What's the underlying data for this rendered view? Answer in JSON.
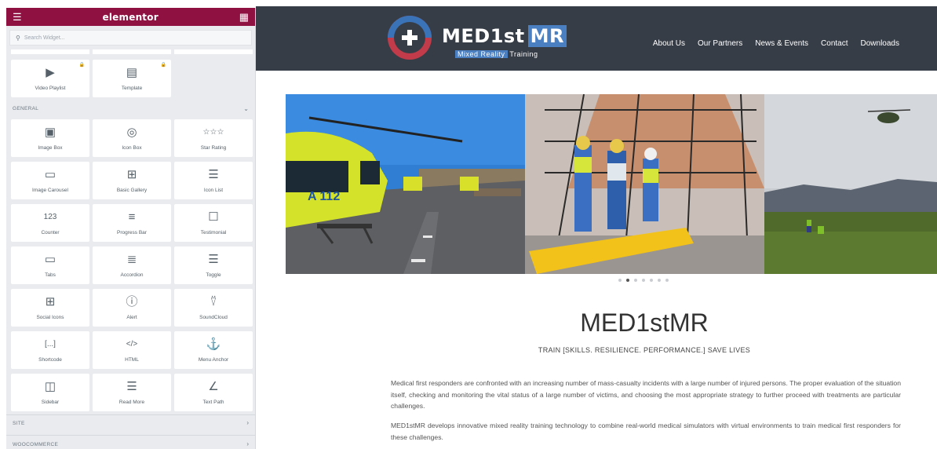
{
  "panel": {
    "brand": "elementor",
    "search_placeholder": "Search Widget...",
    "top_widgets": [
      {
        "label": "Video Playlist",
        "icon": "video-playlist-icon",
        "locked": true
      },
      {
        "label": "Template",
        "icon": "template-icon",
        "locked": true
      }
    ],
    "general_section": {
      "title": "GENERAL",
      "widgets": [
        {
          "label": "Image Box",
          "icon": "image-box-icon"
        },
        {
          "label": "Icon Box",
          "icon": "icon-box-icon"
        },
        {
          "label": "Star Rating",
          "icon": "star-rating-icon"
        },
        {
          "label": "Image Carousel",
          "icon": "image-carousel-icon"
        },
        {
          "label": "Basic Gallery",
          "icon": "basic-gallery-icon"
        },
        {
          "label": "Icon List",
          "icon": "icon-list-icon"
        },
        {
          "label": "Counter",
          "icon": "counter-icon"
        },
        {
          "label": "Progress Bar",
          "icon": "progress-bar-icon"
        },
        {
          "label": "Testimonial",
          "icon": "testimonial-icon"
        },
        {
          "label": "Tabs",
          "icon": "tabs-icon"
        },
        {
          "label": "Accordion",
          "icon": "accordion-icon"
        },
        {
          "label": "Toggle",
          "icon": "toggle-icon"
        },
        {
          "label": "Social Icons",
          "icon": "social-icons-icon"
        },
        {
          "label": "Alert",
          "icon": "alert-icon"
        },
        {
          "label": "SoundCloud",
          "icon": "soundcloud-icon"
        },
        {
          "label": "Shortcode",
          "icon": "shortcode-icon"
        },
        {
          "label": "HTML",
          "icon": "html-icon"
        },
        {
          "label": "Menu Anchor",
          "icon": "menu-anchor-icon"
        },
        {
          "label": "Sidebar",
          "icon": "sidebar-icon"
        },
        {
          "label": "Read More",
          "icon": "read-more-icon"
        },
        {
          "label": "Text Path",
          "icon": "text-path-icon"
        }
      ]
    },
    "site_section": "SITE",
    "woo_section": "WOOCOMMERCE"
  },
  "site": {
    "logo_main": "MED1st",
    "logo_mr": "MR",
    "logo_sub_a": "Mixed Reality",
    "logo_sub_b": "Training",
    "nav": [
      "About Us",
      "Our Partners",
      "News & Events",
      "Contact",
      "Downloads"
    ],
    "slider": {
      "dot_count": 7,
      "active_dot": 1
    },
    "title": "MED1stMR",
    "tagline": "TRAIN [SKILLS. RESILIENCE. PERFORMANCE.] SAVE LIVES",
    "paragraph_1": "Medical first responders are confronted with an increasing number of mass-casualty incidents with a large number of injured persons. The proper evaluation of the situation itself, checking and monitoring the vital status of a large number of victims, and choosing the most appropriate strategy to further proceed with treatments are particular challenges.",
    "paragraph_2": "MED1stMR develops innovative mixed reality training technology to combine real-world medical simulators with virtual environments to train medical first responders for these challenges.",
    "helicopter_text": "A 112"
  },
  "colors": {
    "panel_header": "#8f1142",
    "site_header": "#373d46",
    "logo_blue": "#4a7fc1",
    "logo_red": "#c23b4a"
  }
}
